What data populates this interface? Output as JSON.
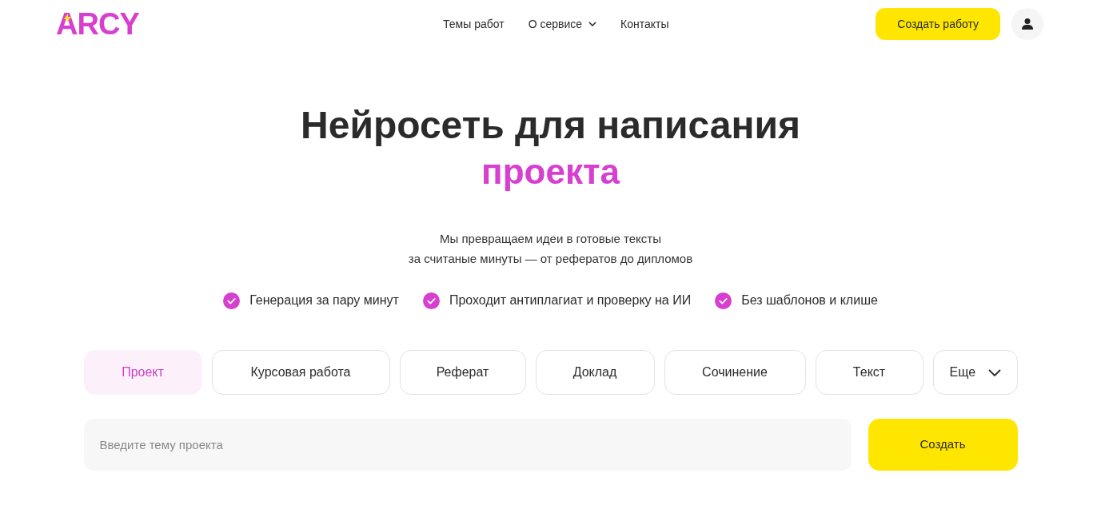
{
  "logo": "ARCY",
  "nav": [
    {
      "label": "Темы работ",
      "dropdown": false
    },
    {
      "label": "О сервисе",
      "dropdown": true
    },
    {
      "label": "Контакты",
      "dropdown": false
    }
  ],
  "header_button": "Создать работу",
  "headline": "Нейросеть для написания",
  "headline_accent": "проекта",
  "subtitle_lines": [
    "Мы превращаем идеи в готовые тексты",
    "за считаные минуты — от рефератов до дипломов"
  ],
  "features": [
    "Генерация за пару минут",
    "Проходит антиплагиат и проверку на ИИ",
    "Без шаблонов и клише"
  ],
  "tabs": [
    {
      "label": "Проект",
      "selected": true,
      "kind": "tab"
    },
    {
      "label": "Курсовая работа",
      "selected": false,
      "kind": "tab"
    },
    {
      "label": "Реферат",
      "selected": false,
      "kind": "tab"
    },
    {
      "label": "Доклад",
      "selected": false,
      "kind": "tab"
    },
    {
      "label": "Сочинение",
      "selected": false,
      "kind": "tab"
    },
    {
      "label": "Текст",
      "selected": false,
      "kind": "tab"
    },
    {
      "label": "Еще",
      "selected": false,
      "kind": "more"
    }
  ],
  "topic_field": {
    "placeholder": "Введите тему проекта"
  },
  "submit_button": "Создать"
}
